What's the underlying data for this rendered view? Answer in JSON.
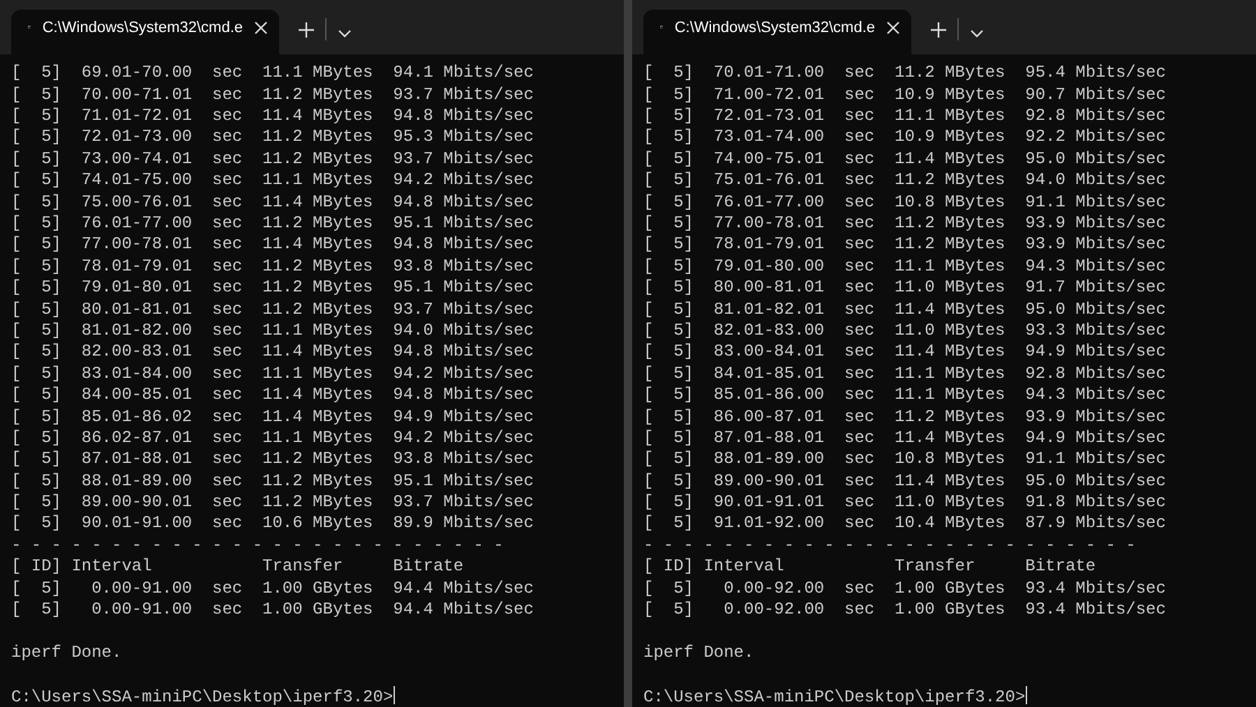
{
  "windows": [
    {
      "tab_title": "C:\\Windows\\System32\\cmd.e",
      "interval_rows": [
        "[  5]  69.01-70.00  sec  11.1 MBytes  94.1 Mbits/sec",
        "[  5]  70.00-71.01  sec  11.2 MBytes  93.7 Mbits/sec",
        "[  5]  71.01-72.01  sec  11.4 MBytes  94.8 Mbits/sec",
        "[  5]  72.01-73.00  sec  11.2 MBytes  95.3 Mbits/sec",
        "[  5]  73.00-74.01  sec  11.2 MBytes  93.7 Mbits/sec",
        "[  5]  74.01-75.00  sec  11.1 MBytes  94.2 Mbits/sec",
        "[  5]  75.00-76.01  sec  11.4 MBytes  94.8 Mbits/sec",
        "[  5]  76.01-77.00  sec  11.2 MBytes  95.1 Mbits/sec",
        "[  5]  77.00-78.01  sec  11.4 MBytes  94.8 Mbits/sec",
        "[  5]  78.01-79.01  sec  11.2 MBytes  93.8 Mbits/sec",
        "[  5]  79.01-80.01  sec  11.2 MBytes  95.1 Mbits/sec",
        "[  5]  80.01-81.01  sec  11.2 MBytes  93.7 Mbits/sec",
        "[  5]  81.01-82.00  sec  11.1 MBytes  94.0 Mbits/sec",
        "[  5]  82.00-83.01  sec  11.4 MBytes  94.8 Mbits/sec",
        "[  5]  83.01-84.00  sec  11.1 MBytes  94.2 Mbits/sec",
        "[  5]  84.00-85.01  sec  11.4 MBytes  94.8 Mbits/sec",
        "[  5]  85.01-86.02  sec  11.4 MBytes  94.9 Mbits/sec",
        "[  5]  86.02-87.01  sec  11.1 MBytes  94.2 Mbits/sec",
        "[  5]  87.01-88.01  sec  11.2 MBytes  93.8 Mbits/sec",
        "[  5]  88.01-89.00  sec  11.2 MBytes  95.1 Mbits/sec",
        "[  5]  89.00-90.01  sec  11.2 MBytes  93.7 Mbits/sec",
        "[  5]  90.01-91.00  sec  10.6 MBytes  89.9 Mbits/sec"
      ],
      "separator": "- - - - - - - - - - - - - - - - - - - - - - - - -",
      "summary_header": "[ ID] Interval           Transfer     Bitrate",
      "summary_rows": [
        "[  5]   0.00-91.00  sec  1.00 GBytes  94.4 Mbits/sec",
        "[  5]   0.00-91.00  sec  1.00 GBytes  94.4 Mbits/sec"
      ],
      "status": "iperf Done.",
      "prompt": "C:\\Users\\SSA-miniPC\\Desktop\\iperf3.20>"
    },
    {
      "tab_title": "C:\\Windows\\System32\\cmd.e",
      "interval_rows": [
        "[  5]  70.01-71.00  sec  11.2 MBytes  95.4 Mbits/sec",
        "[  5]  71.00-72.01  sec  10.9 MBytes  90.7 Mbits/sec",
        "[  5]  72.01-73.01  sec  11.1 MBytes  92.8 Mbits/sec",
        "[  5]  73.01-74.00  sec  10.9 MBytes  92.2 Mbits/sec",
        "[  5]  74.00-75.01  sec  11.4 MBytes  95.0 Mbits/sec",
        "[  5]  75.01-76.01  sec  11.2 MBytes  94.0 Mbits/sec",
        "[  5]  76.01-77.00  sec  10.8 MBytes  91.1 Mbits/sec",
        "[  5]  77.00-78.01  sec  11.2 MBytes  93.9 Mbits/sec",
        "[  5]  78.01-79.01  sec  11.2 MBytes  93.9 Mbits/sec",
        "[  5]  79.01-80.00  sec  11.1 MBytes  94.3 Mbits/sec",
        "[  5]  80.00-81.01  sec  11.0 MBytes  91.7 Mbits/sec",
        "[  5]  81.01-82.01  sec  11.4 MBytes  95.0 Mbits/sec",
        "[  5]  82.01-83.00  sec  11.0 MBytes  93.3 Mbits/sec",
        "[  5]  83.00-84.01  sec  11.4 MBytes  94.9 Mbits/sec",
        "[  5]  84.01-85.01  sec  11.1 MBytes  92.8 Mbits/sec",
        "[  5]  85.01-86.00  sec  11.1 MBytes  94.3 Mbits/sec",
        "[  5]  86.00-87.01  sec  11.2 MBytes  93.9 Mbits/sec",
        "[  5]  87.01-88.01  sec  11.4 MBytes  94.9 Mbits/sec",
        "[  5]  88.01-89.00  sec  10.8 MBytes  91.1 Mbits/sec",
        "[  5]  89.00-90.01  sec  11.4 MBytes  95.0 Mbits/sec",
        "[  5]  90.01-91.01  sec  11.0 MBytes  91.8 Mbits/sec",
        "[  5]  91.01-92.00  sec  10.4 MBytes  87.9 Mbits/sec"
      ],
      "separator": "- - - - - - - - - - - - - - - - - - - - - - - - -",
      "summary_header": "[ ID] Interval           Transfer     Bitrate",
      "summary_rows": [
        "[  5]   0.00-92.00  sec  1.00 GBytes  93.4 Mbits/sec",
        "[  5]   0.00-92.00  sec  1.00 GBytes  93.4 Mbits/sec"
      ],
      "status": "iperf Done.",
      "prompt": "C:\\Users\\SSA-miniPC\\Desktop\\iperf3.20>"
    }
  ]
}
